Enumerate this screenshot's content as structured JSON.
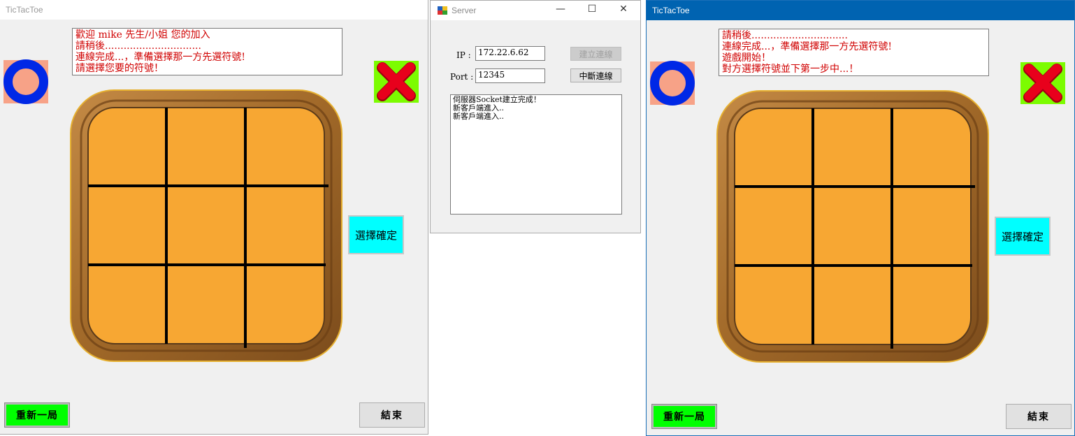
{
  "left_window": {
    "title": "TicTacToe",
    "messages": [
      "歡迎 mike 先生/小姐 您的加入",
      "請稍後...............................",
      "連線完成...，準備選擇那一方先選符號!",
      "請選擇您要的符號！"
    ],
    "symbol_o": "O",
    "symbol_x": "X",
    "confirm_label": "選擇確定",
    "restart_label": "重新一局",
    "end_label": "結束"
  },
  "server_window": {
    "title": "Server",
    "ip_label": "IP :",
    "ip_value": "172.22.6.62",
    "port_label": "Port :",
    "port_value": "12345",
    "connect_label": "建立連線",
    "disconnect_label": "中斷連線",
    "log_lines": [
      "伺服器Socket建立完成！",
      "新客戶端進入..",
      "新客戶端進入.."
    ]
  },
  "right_window": {
    "title": "TicTacToe",
    "messages": [
      "請稍後...............................",
      "連線完成...，準備選擇那一方先選符號!",
      "遊戲開始！",
      "對方選擇符號並下第一步中...！"
    ],
    "symbol_o": "O",
    "symbol_x": "X",
    "confirm_label": "選擇確定",
    "restart_label": "重新一局",
    "end_label": "結束"
  },
  "colors": {
    "message_text": "#d00000",
    "board_fill": "#f7a733",
    "frame_wood": "#a8702e",
    "confirm_bg": "#00ffff",
    "restart_bg": "#00ff00",
    "o_ring": "#0028e6",
    "x_red": "#e8001c",
    "x_bg": "#7cfc00",
    "active_title": "#0063b1"
  }
}
